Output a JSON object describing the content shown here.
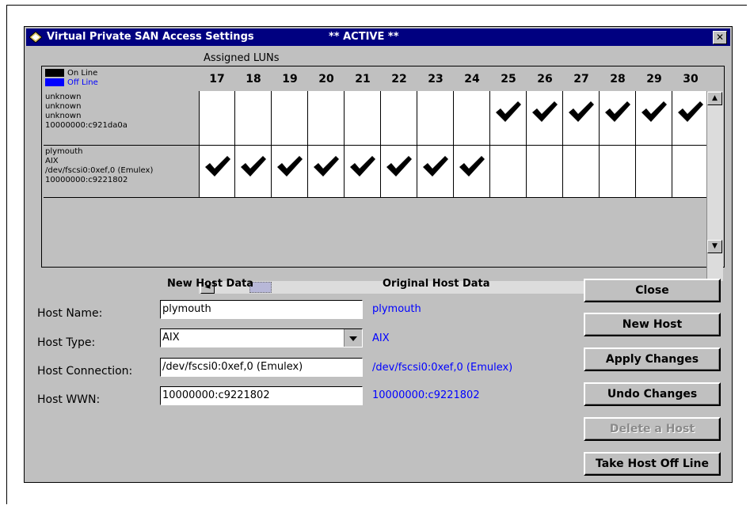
{
  "window": {
    "title": "Virtual Private SAN Access Settings",
    "status": "** ACTIVE **",
    "close_glyph": "✕"
  },
  "grid": {
    "caption": "Assigned LUNs",
    "legend": {
      "online_label": "On Line",
      "offline_label": "Off Line",
      "online_color": "#000000",
      "offline_color": "#0000ff"
    },
    "luns": [
      "17",
      "18",
      "19",
      "20",
      "21",
      "22",
      "23",
      "24",
      "25",
      "26",
      "27",
      "28",
      "29",
      "30"
    ],
    "hosts": [
      {
        "lines": [
          "unknown",
          "unknown",
          "unknown",
          "10000000:c921da0a"
        ],
        "assigned": [
          false,
          false,
          false,
          false,
          false,
          false,
          false,
          false,
          true,
          true,
          true,
          true,
          true,
          true
        ]
      },
      {
        "lines": [
          "plymouth",
          "AIX",
          "/dev/fscsi0:0xef,0 (Emulex)",
          "10000000:c9221802"
        ],
        "assigned": [
          true,
          true,
          true,
          true,
          true,
          true,
          true,
          true,
          false,
          false,
          false,
          false,
          false,
          false
        ]
      }
    ],
    "scroll_left": "◄",
    "scroll_right": "►",
    "scroll_up": "▲",
    "scroll_down": "▼"
  },
  "form": {
    "new_heading": "New Host Data",
    "orig_heading": "Original Host Data",
    "fields": [
      {
        "label": "Host Name:",
        "value": "plymouth",
        "original": "plymouth"
      },
      {
        "label": "Host Type:",
        "value": "AIX",
        "original": "AIX"
      },
      {
        "label": "Host Connection:",
        "value": "/dev/fscsi0:0xef,0 (Emulex)",
        "original": "/dev/fscsi0:0xef,0 (Emulex)"
      },
      {
        "label": "Host WWN:",
        "value": "10000000:c9221802",
        "original": "10000000:c9221802"
      }
    ]
  },
  "buttons": {
    "close": "Close",
    "new_host": "New Host",
    "apply": "Apply Changes",
    "undo": "Undo Changes",
    "delete": "Delete a Host",
    "offline": "Take Host Off Line"
  },
  "colors": {
    "titlebar": "#000080",
    "original_text": "#0000ff",
    "window_bg": "#c0c0c0"
  }
}
